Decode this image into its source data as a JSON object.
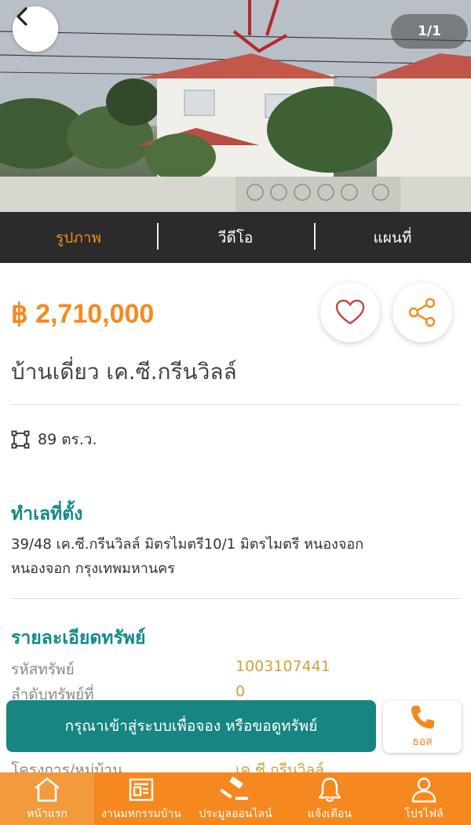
{
  "gallery": {
    "counter": "1/1"
  },
  "media_tabs": [
    {
      "label": "รูปภาพ",
      "active": true
    },
    {
      "label": "วีดีโอ",
      "active": false
    },
    {
      "label": "แผนที่",
      "active": false
    }
  ],
  "listing": {
    "price": "฿ 2,710,000",
    "title": "บ้านเดี่ยว เค.ซี.กรีนวิลล์",
    "area": "89 ตร.ว."
  },
  "location": {
    "heading": "ทำเลที่ตั้ง",
    "address_line1": "39/48 เค.ซี.กรีนวิลล์ มิตรไมตรี10/1 มิตรไมตรี หนองจอก",
    "address_line2": "หนองจอก กรุงเทพมหานคร"
  },
  "details": {
    "heading": "รายละเอียดทรัพย์",
    "rows": [
      {
        "label": "รหัสทรัพย์",
        "value": "1003107441"
      },
      {
        "label": "ลำดับทรัพย์ที่",
        "value": "0"
      },
      {
        "label": "โครงการ/หมู่บ้าน",
        "value": "เค.ซี.กรีนวิลล์"
      }
    ]
  },
  "cta": {
    "label": "กรุณาเข้าสู่ระบบเพื่อจอง หรือขอดูทรัพย์",
    "call_label": "ธอส"
  },
  "bottom_nav": [
    {
      "label": "หน้าแรก",
      "icon": "home-icon"
    },
    {
      "label": "งานมหกรรมบ้าน",
      "icon": "newspaper-icon"
    },
    {
      "label": "ประมูลออนไลน์",
      "icon": "gavel-icon"
    },
    {
      "label": "แจ้งเตือน",
      "icon": "bell-icon"
    },
    {
      "label": "โปรไฟล์",
      "icon": "user-icon"
    }
  ],
  "colors": {
    "accent": "#f5891f",
    "teal": "#178582",
    "heading_teal": "#138a8a",
    "tab_bar": "#2b2b2b"
  }
}
